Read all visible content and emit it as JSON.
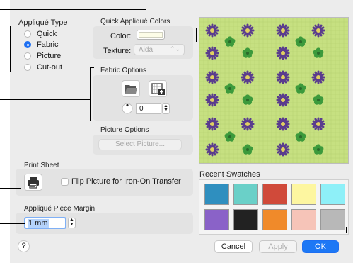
{
  "applique_type": {
    "title": "Appliqué Type",
    "options": [
      "Quick",
      "Fabric",
      "Picture",
      "Cut-out"
    ],
    "selected": "Fabric"
  },
  "quick_colors": {
    "title": "Quick Appliqué Colors",
    "color_label": "Color:",
    "color_value": "#fdfde8",
    "texture_label": "Texture:",
    "texture_value": "Aida"
  },
  "fabric_options": {
    "title": "Fabric Options",
    "open_icon": "folder-open-icon",
    "add_icon": "fabric-add-icon",
    "angle_value": "0"
  },
  "picture_options": {
    "title": "Picture Options",
    "button_label": "Select Picture..."
  },
  "print_sheet": {
    "title": "Print Sheet",
    "printer_icon": "printer-icon",
    "flip_label": "Flip Picture for Iron-On Transfer",
    "flip_checked": false
  },
  "margin": {
    "title": "Appliqué Piece Margin",
    "value": "1 mm"
  },
  "preview": {
    "background_color": "#c6e081",
    "flower_color": "#5a3c8e",
    "leaf_color": "#3c9a3c"
  },
  "recent_swatches": {
    "title": "Recent Swatches",
    "items": [
      {
        "name": "swatch-blue-sea",
        "color": "#2f8fbf"
      },
      {
        "name": "swatch-teal-pattern",
        "color": "#6ad0c8"
      },
      {
        "name": "swatch-clown",
        "color": "#d04a3a"
      },
      {
        "name": "swatch-pale-yellow",
        "color": "#fdf6a0"
      },
      {
        "name": "swatch-cyan",
        "color": "#8ef0f8"
      },
      {
        "name": "swatch-purple-tiles",
        "color": "#8a62c8"
      },
      {
        "name": "swatch-stars",
        "color": "#222222"
      },
      {
        "name": "swatch-orange-pattern",
        "color": "#f08a2a"
      },
      {
        "name": "swatch-pink-checks",
        "color": "#f6c4b8"
      },
      {
        "name": "swatch-grey-scales",
        "color": "#b8b8b8"
      }
    ]
  },
  "footer": {
    "help_label": "?",
    "cancel_label": "Cancel",
    "apply_label": "Apply",
    "ok_label": "OK"
  }
}
